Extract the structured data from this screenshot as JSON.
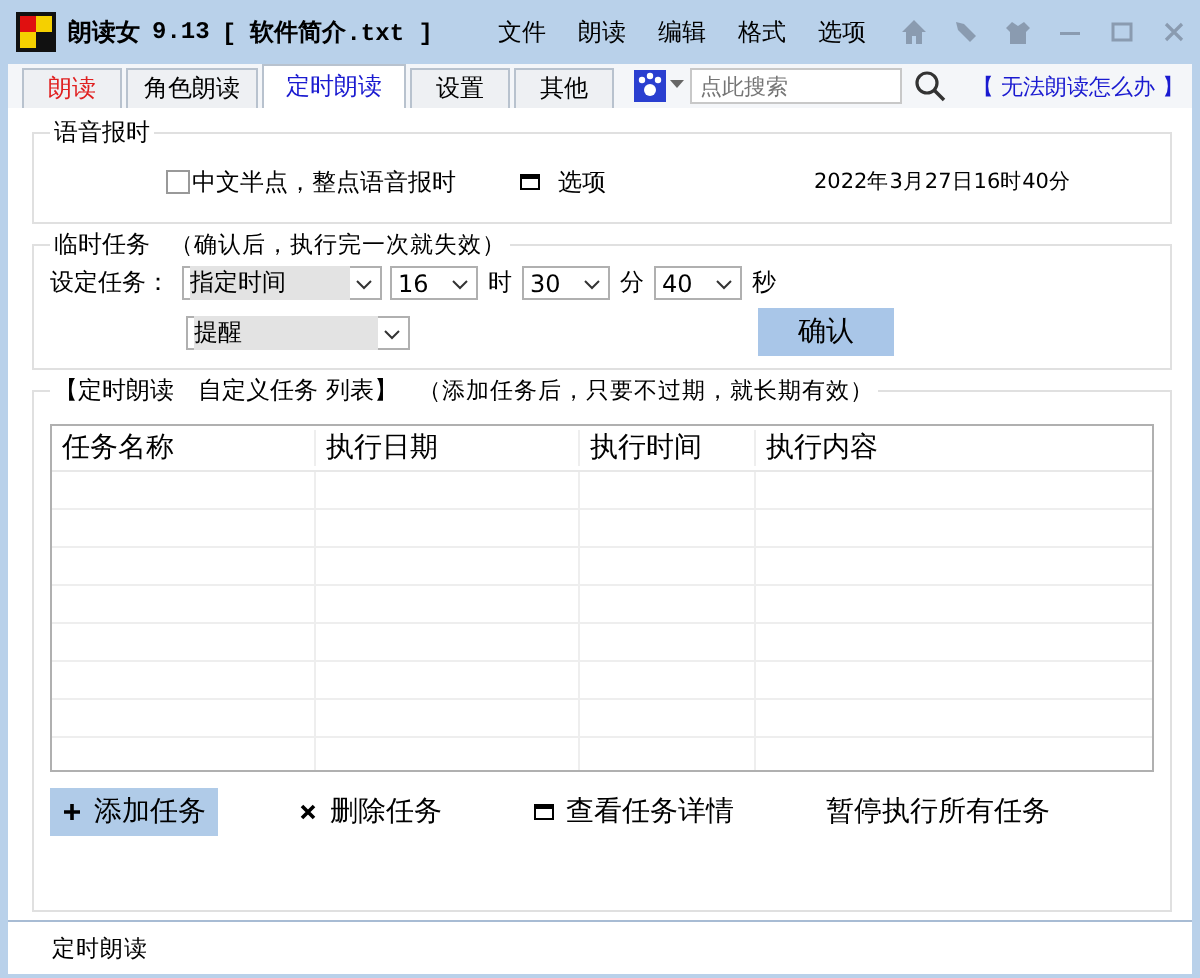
{
  "window": {
    "app_name": "朗读女",
    "version": "9.13",
    "file": "[ 软件简介.txt ]"
  },
  "menu": [
    "文件",
    "朗读",
    "编辑",
    "格式",
    "选项"
  ],
  "tabs": [
    {
      "label": "朗读",
      "selected": false,
      "color": "#e02020"
    },
    {
      "label": "角色朗读",
      "selected": false,
      "color": "#000000"
    },
    {
      "label": "定时朗读",
      "selected": true,
      "color": "#1a1ad0"
    },
    {
      "label": "设置",
      "selected": false,
      "color": "#000000"
    },
    {
      "label": "其他",
      "selected": false,
      "color": "#000000"
    }
  ],
  "search": {
    "placeholder": "点此搜索"
  },
  "help_link": "【 无法朗读怎么办 】",
  "voice_report": {
    "title": "语音报时",
    "checkbox": {
      "label": "中文半点，整点语音报时",
      "checked": false
    },
    "options_button": "选项",
    "datetime": "2022年3月27日16时40分"
  },
  "temp_task": {
    "title": "临时任务",
    "note": "（确认后，执行完一次就失效）",
    "label": "设定任务：",
    "mode": "指定时间",
    "hour": "16",
    "hour_unit": "时",
    "minute": "30",
    "minute_unit": "分",
    "second": "40",
    "second_unit": "秒",
    "action": "提醒",
    "confirm": "确认"
  },
  "task_list": {
    "title": "【定时朗读　自定义任务 列表】",
    "note": "（添加任务后，只要不过期，就长期有效）",
    "columns": [
      "任务名称",
      "执行日期",
      "执行时间",
      "执行内容"
    ],
    "buttons": [
      {
        "label": "添加任务",
        "kind": "plus",
        "selected": true
      },
      {
        "label": "删除任务",
        "kind": "cross",
        "selected": false
      },
      {
        "label": "查看任务详情",
        "kind": "window",
        "selected": false
      },
      {
        "label": "暂停执行所有任务",
        "kind": "none",
        "selected": false
      }
    ]
  },
  "status_bar": "定时朗读"
}
